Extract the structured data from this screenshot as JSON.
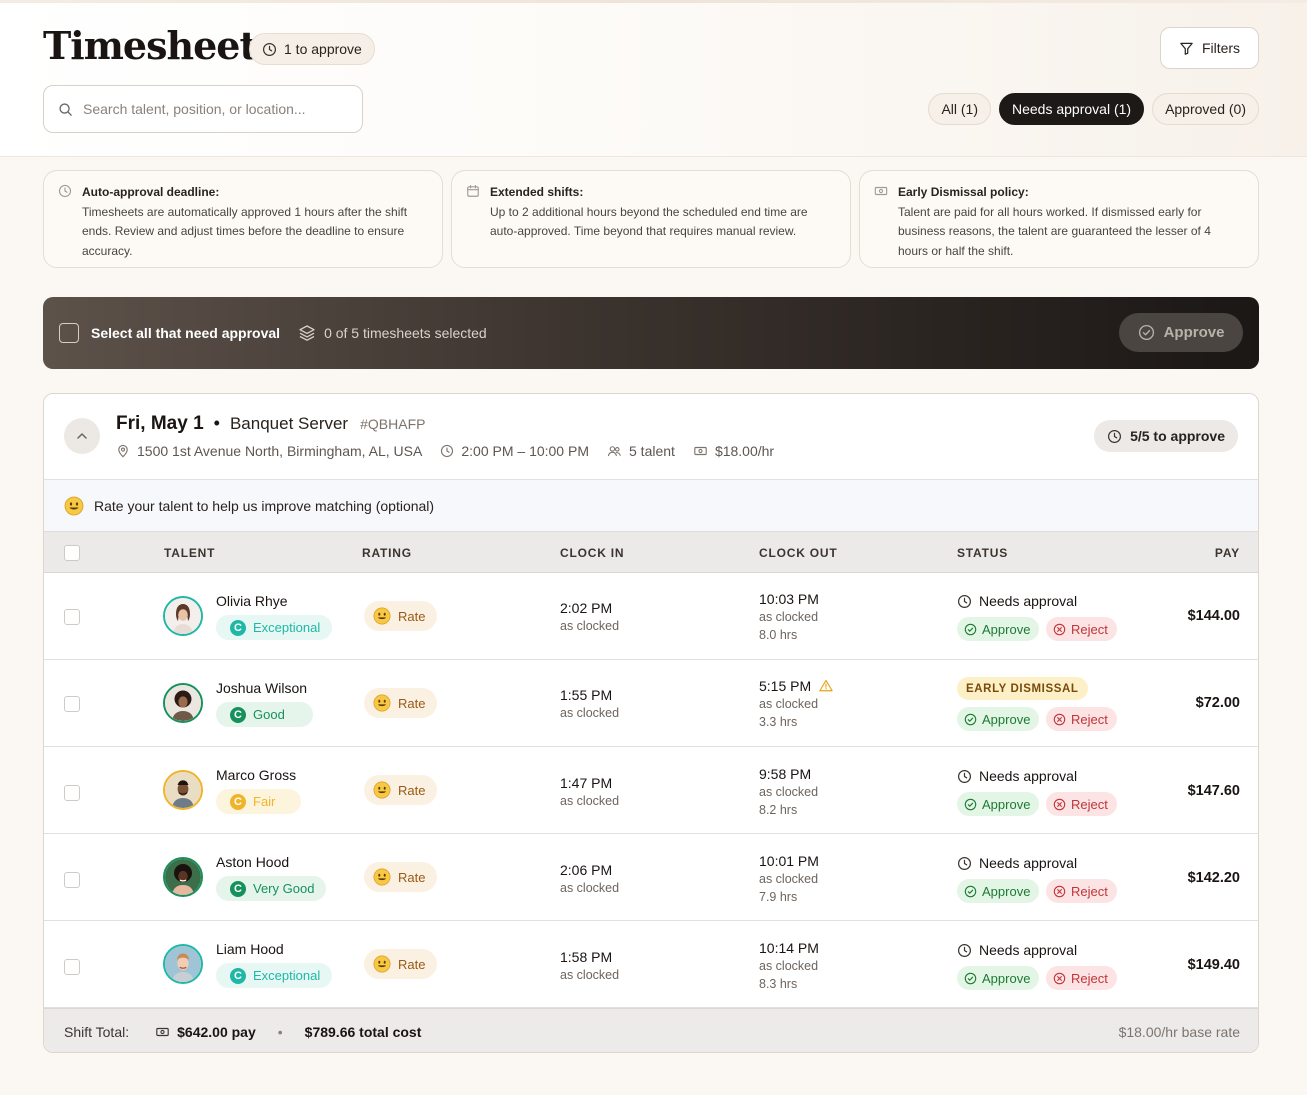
{
  "page": {
    "title": "Timesheets",
    "pending_badge": "1 to approve",
    "filters_label": "Filters",
    "search_placeholder": "Search talent, position, or location..."
  },
  "tabs": [
    {
      "label": "All (1)",
      "active": false
    },
    {
      "label": "Needs approval (1)",
      "active": true
    },
    {
      "label": "Approved (0)",
      "active": false
    }
  ],
  "info_cards": [
    {
      "title": "Auto-approval deadline:",
      "body": "Timesheets are automatically approved 1 hours after the shift ends. Review and adjust times before the deadline to ensure accuracy.",
      "icon": "clock-icon"
    },
    {
      "title": "Extended shifts:",
      "body": "Up to 2 additional hours beyond the scheduled end time are auto-approved. Time beyond that requires manual review.",
      "icon": "calendar-icon"
    },
    {
      "title": "Early Dismissal policy:",
      "body": "Talent are paid for all hours worked. If dismissed early for business reasons, the talent are guaranteed the lesser of 4 hours or half the shift.",
      "icon": "money-icon"
    }
  ],
  "bulk": {
    "select_label": "Select all that need approval",
    "selected_count": "0 of 5 timesheets selected",
    "approve_label": "Approve"
  },
  "shift": {
    "date": "Fri, May 1",
    "separator": "•",
    "position": "Banquet Server",
    "code": "#QBHAFP",
    "address": "1500 1st Avenue North, Birmingham, AL, USA",
    "time_range": "2:00 PM – 10:00 PM",
    "talent_count": "5 talent",
    "rate": "$18.00/hr",
    "to_approve": "5/5 to approve",
    "rate_banner_bold": "Rate your talent",
    "rate_banner_rest": " to help us improve matching (optional)"
  },
  "columns": {
    "talent": "TALENT",
    "rating": "RATING",
    "clock_in": "CLOCK IN",
    "clock_out": "CLOCK OUT",
    "status": "STATUS",
    "pay": "PAY"
  },
  "rows": [
    {
      "name": "Olivia Rhye",
      "tier": "Exceptional",
      "tier_color": "#1fb8a6",
      "tier_bg": "#e6f7f4",
      "rate": "Rate",
      "in": "2:02 PM",
      "in_note": "as clocked",
      "out": "10:03 PM",
      "out_note": "as clocked",
      "hours": "8.0 hrs",
      "status": "Needs approval",
      "early": false,
      "approve": "Approve",
      "reject": "Reject",
      "pay": "$144.00"
    },
    {
      "name": "Joshua Wilson",
      "tier": "Good",
      "tier_color": "#17915c",
      "tier_bg": "#e5f5ec",
      "rate": "Rate",
      "in": "1:55 PM",
      "in_note": "as clocked",
      "out": "5:15 PM",
      "out_note": "as clocked",
      "hours": "3.3 hrs",
      "status": "EARLY DISMISSAL",
      "early": true,
      "approve": "Approve",
      "reject": "Reject",
      "pay": "$72.00"
    },
    {
      "name": "Marco Gross",
      "tier": "Fair",
      "tier_color": "#f0b429",
      "tier_bg": "#fdf4dd",
      "rate": "Rate",
      "in": "1:47 PM",
      "in_note": "as clocked",
      "out": "9:58 PM",
      "out_note": "as clocked",
      "hours": "8.2 hrs",
      "status": "Needs approval",
      "early": false,
      "approve": "Approve",
      "reject": "Reject",
      "pay": "$147.60"
    },
    {
      "name": "Aston Hood",
      "tier": "Very Good",
      "tier_color": "#17915c",
      "tier_bg": "#e5f5ec",
      "rate": "Rate",
      "in": "2:06 PM",
      "in_note": "as clocked",
      "out": "10:01 PM",
      "out_note": "as clocked",
      "hours": "7.9 hrs",
      "status": "Needs approval",
      "early": false,
      "approve": "Approve",
      "reject": "Reject",
      "pay": "$142.20"
    },
    {
      "name": "Liam Hood",
      "tier": "Exceptional",
      "tier_color": "#1fb8a6",
      "tier_bg": "#e6f7f4",
      "rate": "Rate",
      "in": "1:58 PM",
      "in_note": "as clocked",
      "out": "10:14 PM",
      "out_note": "as clocked",
      "hours": "8.3 hrs",
      "status": "Needs approval",
      "early": false,
      "approve": "Approve",
      "reject": "Reject",
      "pay": "$149.40"
    }
  ],
  "footer": {
    "label": "Shift Total:",
    "pay": "$642.00 pay",
    "separator": "•",
    "total_cost": "$789.66 total cost",
    "base_rate": "$18.00/hr base rate"
  },
  "colors": {
    "accent_dark": "#1d1916",
    "approve_green": "#1d7a35",
    "reject_red": "#c0353a",
    "warning": "#e8a317"
  }
}
